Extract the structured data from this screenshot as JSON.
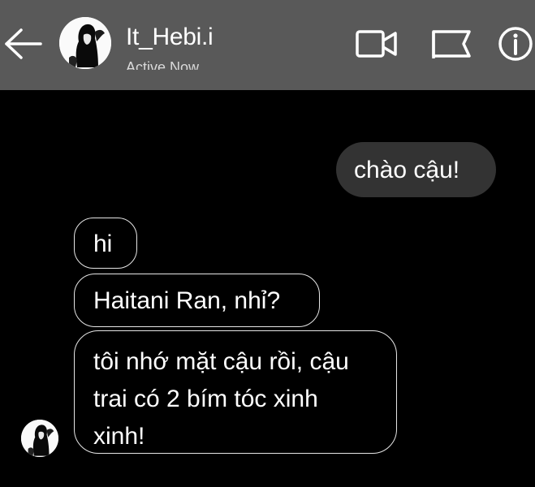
{
  "header": {
    "username": "It_Hebi.i",
    "status": "Active Now",
    "icons": [
      "back-arrow-icon",
      "avatar",
      "video-call-icon",
      "flag-icon",
      "info-icon"
    ]
  },
  "messages": {
    "sent": [
      {
        "text": "chào cậu!"
      }
    ],
    "received": [
      {
        "text": "hi"
      },
      {
        "text": "Haitani Ran, nhỉ?"
      },
      {
        "lines": [
          "tôi nhớ mặt cậu rồi, cậu",
          "trai có 2 bím tóc xinh",
          "xinh!"
        ]
      }
    ]
  },
  "colors": {
    "header_bg": "#595959",
    "chat_bg": "#000000",
    "sent_bubble": "#333333",
    "received_border": "#e6e6e6"
  }
}
